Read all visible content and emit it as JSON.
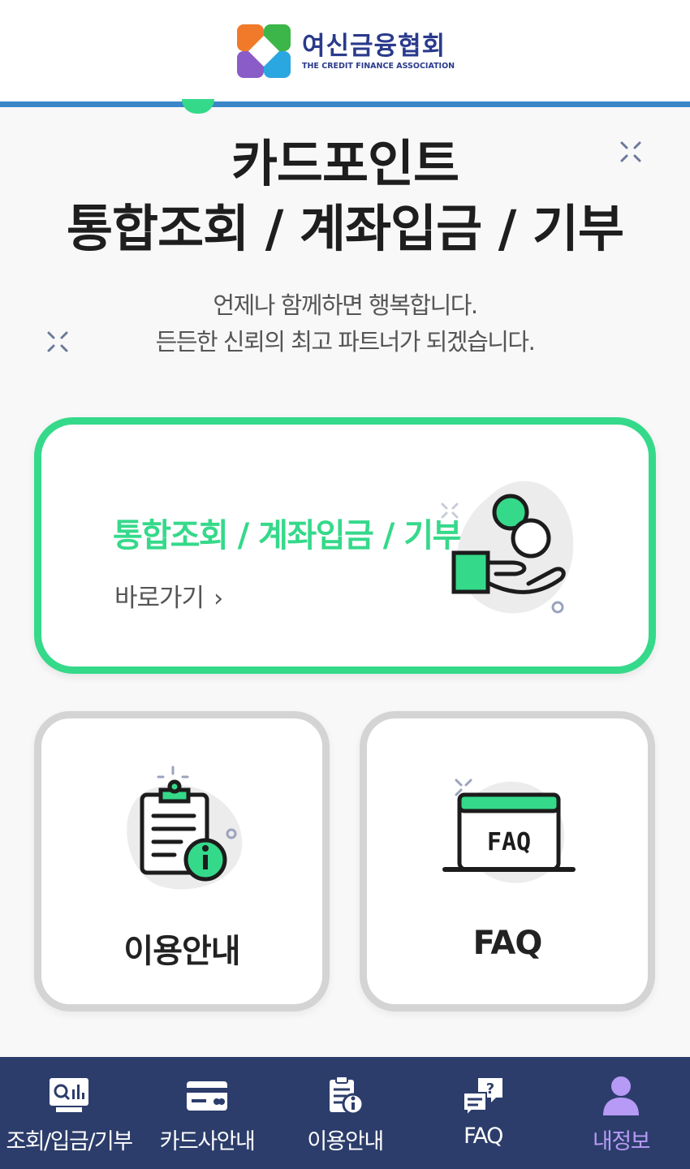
{
  "header": {
    "logo_ko": "여신금융협회",
    "logo_en": "THE CREDIT FINANCE ASSOCIATION"
  },
  "hero": {
    "title_line1": "카드포인트",
    "title_line2": "통합조회 / 계좌입금 / 기부",
    "subtitle_line1": "언제나 함께하면 행복합니다.",
    "subtitle_line2": "든든한 신뢰의 최고 파트너가 되겠습니다."
  },
  "main_card": {
    "title": "통합조회 / 계좌입금 / 기부",
    "link_label": "바로가기",
    "arrow": "›"
  },
  "cards": {
    "guide_label": "이용안내",
    "faq_label": "FAQ",
    "faq_icon_text": "FAQ"
  },
  "bottom_nav": {
    "items": [
      {
        "label": "조회/입금/기부",
        "icon": "monitor-chart-icon"
      },
      {
        "label": "카드사안내",
        "icon": "credit-card-icon"
      },
      {
        "label": "이용안내",
        "icon": "clipboard-info-icon"
      },
      {
        "label": "FAQ",
        "icon": "faq-bubble-icon"
      },
      {
        "label": "내정보",
        "icon": "user-icon"
      }
    ],
    "active_index": 4
  },
  "colors": {
    "accent_green": "#35d98a",
    "header_blue": "#3a86c8",
    "nav_bg": "#2c3d6b",
    "nav_active": "#b79af5"
  }
}
